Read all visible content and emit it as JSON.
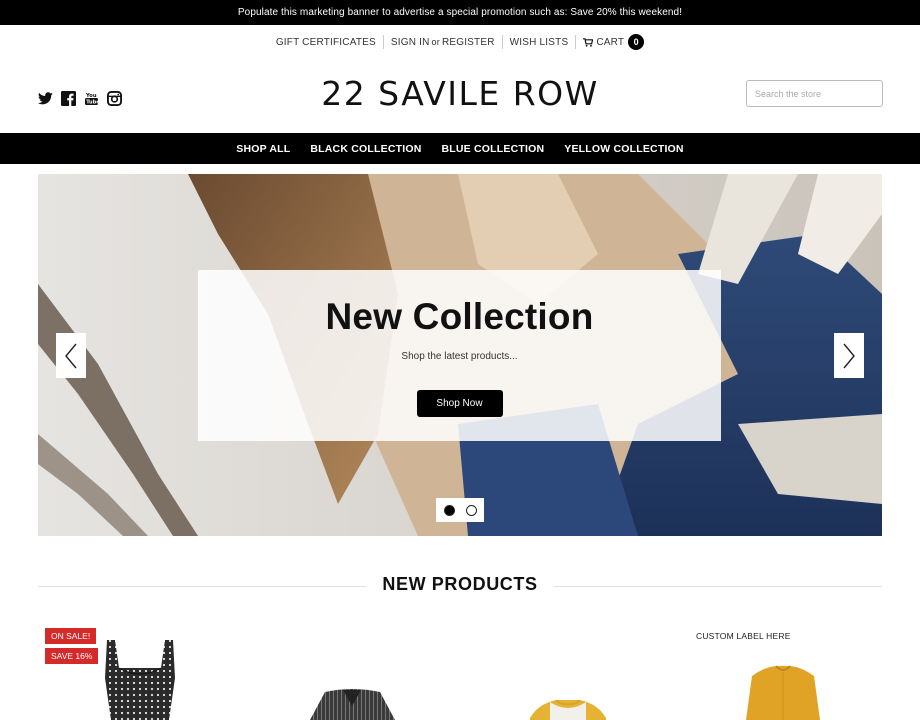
{
  "promo_banner": "Populate this marketing banner to advertise a special promotion such as: Save 20% this weekend!",
  "util_nav": {
    "gift_certificates": "GIFT CERTIFICATES",
    "sign_in": "SIGN IN",
    "or": "or",
    "register": "REGISTER",
    "wish_lists": "WISH LISTS",
    "cart": "CART",
    "cart_count": "0"
  },
  "social": [
    "twitter-icon",
    "facebook-icon",
    "youtube-icon",
    "instagram-icon"
  ],
  "logo": "22 SAVILE ROW",
  "search": {
    "placeholder": "Search the store"
  },
  "main_nav": [
    "SHOP ALL",
    "BLACK COLLECTION",
    "BLUE COLLECTION",
    "YELLOW COLLECTION"
  ],
  "hero": {
    "title": "New Collection",
    "subtitle": "Shop the latest products...",
    "button": "Shop Now",
    "slides": 2,
    "active_slide": 1
  },
  "section_title": "NEW PRODUCTS",
  "products": [
    {
      "badges": [
        "ON SALE!",
        "SAVE 16%"
      ],
      "image": "polka-dot-tank-dress"
    },
    {
      "badges": [],
      "image": "striped-blazer"
    },
    {
      "badges": [],
      "image": "raglan-tee"
    },
    {
      "custom_label": "CUSTOM LABEL HERE",
      "image": "yellow-blouse"
    }
  ],
  "colors": {
    "black": "#000000",
    "sale_badge": "#d42a2a"
  }
}
